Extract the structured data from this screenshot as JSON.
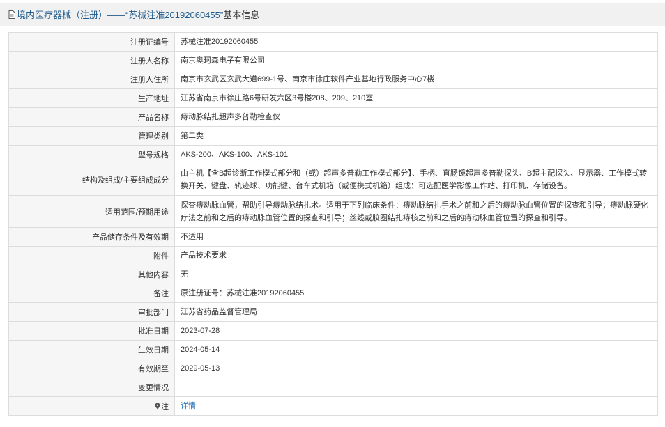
{
  "header": {
    "title_prefix": "境内医疗器械（注册）——“苏械注准20192060455”",
    "title_suffix": "基本信息"
  },
  "rows": [
    {
      "label": "注册证编号",
      "value": "苏械注准20192060455"
    },
    {
      "label": "注册人名称",
      "value": "南京奥珂森电子有限公司"
    },
    {
      "label": "注册人住所",
      "value": "南京市玄武区玄武大道699-1号、南京市徐庄软件产业基地行政服务中心7楼"
    },
    {
      "label": "生产地址",
      "value": "江苏省南京市徐庄路6号研发六区3号楼208、209、210室"
    },
    {
      "label": "产品名称",
      "value": "痔动脉结扎超声多普勒检查仪"
    },
    {
      "label": "管理类别",
      "value": "第二类"
    },
    {
      "label": "型号规格",
      "value": "AKS-200、AKS-100、AKS-101"
    },
    {
      "label": "结构及组成/主要组成成分",
      "value": "由主机【含B超诊断工作模式部分和（或）超声多普勒工作模式部分】、手柄、直肠镜超声多普勒探头、B超主配探头、显示器、工作模式转换开关、键盘、轨迹球、功能键、台车式机箱（或便携式机箱）组成；可选配医学影像工作站、打印机、存储设备。"
    },
    {
      "label": "适用范围/预期用途",
      "value": "探查痔动脉血管，帮助引导痔动脉结扎术。适用于下列临床条件：痔动脉结扎手术之前和之后的痔动脉血管位置的探查和引导；痔动脉硬化疗法之前和之后的痔动脉血管位置的探查和引导；丝线或胶圈结扎痔核之前和之后的痔动脉血管位置的探查和引导。"
    },
    {
      "label": "产品储存条件及有效期",
      "value": "不适用"
    },
    {
      "label": "附件",
      "value": "产品技术要求"
    },
    {
      "label": "其他内容",
      "value": "无"
    },
    {
      "label": "备注",
      "value": "原注册证号：苏械注准20192060455"
    },
    {
      "label": "审批部门",
      "value": "江苏省药品监督管理局"
    },
    {
      "label": "批准日期",
      "value": "2023-07-28"
    },
    {
      "label": "生效日期",
      "value": "2024-05-14"
    },
    {
      "label": "有效期至",
      "value": "2029-05-13"
    },
    {
      "label": "变更情况",
      "value": ""
    }
  ],
  "note": {
    "label": "注",
    "link": "详情",
    "icon": "pin-icon"
  },
  "colors": {
    "link": "#1e6bb8",
    "title": "#1e5a8c",
    "label_bg": "#f6f6f6",
    "border": "#dcdcdc"
  }
}
